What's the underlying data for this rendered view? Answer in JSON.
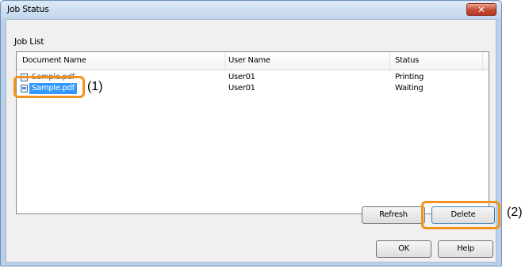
{
  "window": {
    "title": "Job Status",
    "close_label": "✕"
  },
  "job_list": {
    "label": "Job List",
    "columns": [
      "Document Name",
      "User Name",
      "Status"
    ],
    "rows": [
      {
        "document": "Sample.pdf",
        "user": "User01",
        "status": "Printing"
      },
      {
        "document": "Sample.pdf",
        "user": "User01",
        "status": "Waiting"
      }
    ]
  },
  "buttons": {
    "refresh": "Refresh",
    "delete": "Delete",
    "ok": "OK",
    "help": "Help"
  },
  "callouts": {
    "one": "(1)",
    "two": "(2)"
  },
  "colors": {
    "highlight": "#f0921e",
    "selection": "#3399ff"
  }
}
